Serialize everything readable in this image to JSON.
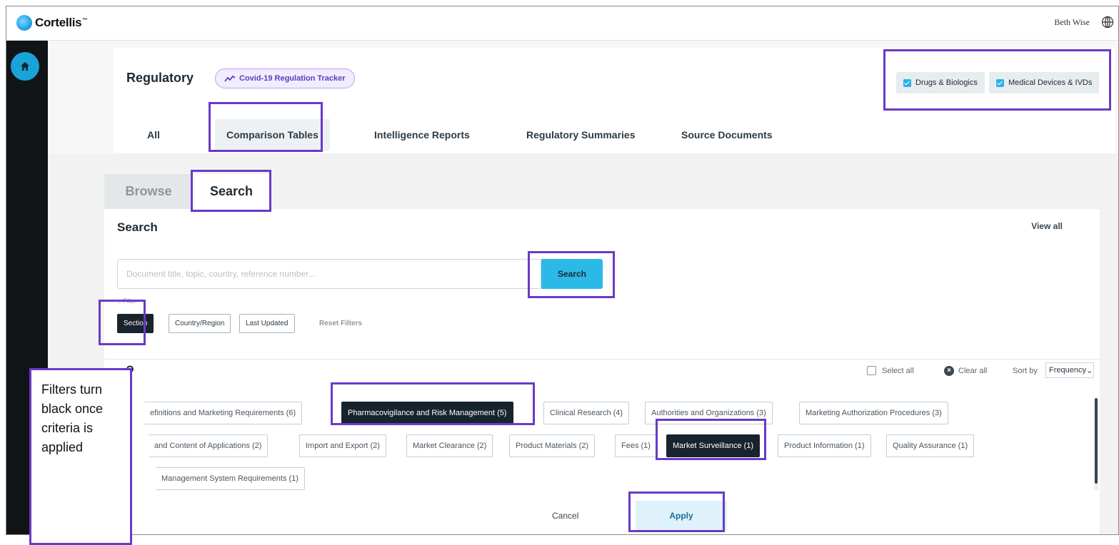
{
  "app": {
    "logo_text": "Cortellis",
    "logo_tm": "™",
    "user_name": "Beth Wise"
  },
  "header": {
    "title": "Regulatory",
    "covid_pill": "Covid-19 Regulation Tracker",
    "checks": [
      "Drugs & Biologics",
      "Medical Devices & IVDs"
    ]
  },
  "tabs": [
    "All",
    "Comparison Tables",
    "Intelligence Reports",
    "Regulatory Summaries",
    "Source Documents"
  ],
  "section_tabs": {
    "browse": "Browse",
    "search": "Search"
  },
  "search": {
    "heading": "Search",
    "view_all": "View all",
    "placeholder": "Document title, topic, country, reference number...",
    "button": "Search",
    "filter_label": "Filter",
    "filters": [
      "Section",
      "Country/Region",
      "Last Updated"
    ],
    "reset": "Reset Filters"
  },
  "panel": {
    "select_all": "Select all",
    "clear_all": "Clear all",
    "sort_by": "Sort by",
    "sort_value": "Frequency",
    "chips_row1": [
      "efinitions and Marketing Requirements (6)",
      "Pharmacovigilance and Risk Management (5)",
      "Clinical Research (4)",
      "Authorities and Organizations (3)",
      "Marketing Authorization Procedures (3)"
    ],
    "chips_row2": [
      "and Content of Applications (2)",
      "Import and Export (2)",
      "Market Clearance (2)",
      "Product Materials (2)",
      "Fees (1)",
      "Market Surveillance (1)",
      "Product Information (1)",
      "Quality Assurance (1)"
    ],
    "chips_row3": [
      "Management System Requirements (1)"
    ],
    "cancel": "Cancel",
    "apply": "Apply"
  },
  "annotation": {
    "text": "Filters turn black once criteria is applied"
  },
  "colors": {
    "accent": "#2bb9e8",
    "highlight": "#6b39c7",
    "dark_chip": "#17232d",
    "nav": "#101417"
  }
}
